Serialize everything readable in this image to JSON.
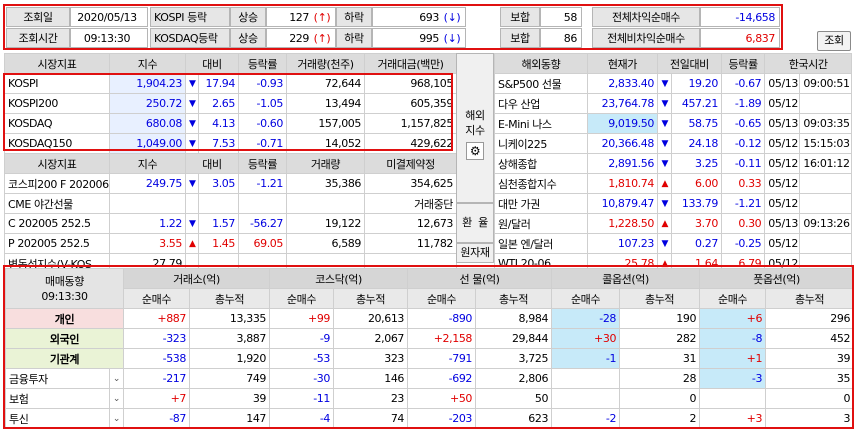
{
  "top": {
    "row1": {
      "date_label": "조회일",
      "date_value": "2020/05/13",
      "kospi_label": "KOSPI 등락",
      "up_label": "상승",
      "up_value": "127",
      "up_arrow": "↑",
      "down_label": "하락",
      "down_value": "693",
      "down_arrow": "↓",
      "flat_label": "보합",
      "flat_value": "58",
      "arb_label": "전체차익순매수",
      "arb_value": "-14,658"
    },
    "row2": {
      "time_label": "조회시간",
      "time_value": "09:13:30",
      "kosdaq_label": "KOSDAQ등락",
      "up_label": "상승",
      "up_value": "229",
      "up_arrow": "↑",
      "down_label": "하락",
      "down_value": "995",
      "down_arrow": "↓",
      "flat_label": "보합",
      "flat_value": "86",
      "nonarb_label": "전체비차익순매수",
      "nonarb_value": "6,837"
    },
    "query_button": "조회"
  },
  "market": {
    "headers": [
      "시장지표",
      "지수",
      "대비",
      "등락률",
      "거래량(천주)",
      "거래대금(백만)"
    ],
    "rows": [
      {
        "name": "KOSPI",
        "index": "1,904.23",
        "arrow": "▼",
        "change": "17.94",
        "rate": "-0.93",
        "volume": "72,644",
        "amount": "968,105"
      },
      {
        "name": "KOSPI200",
        "index": "250.72",
        "arrow": "▼",
        "change": "2.65",
        "rate": "-1.05",
        "volume": "13,494",
        "amount": "605,359"
      },
      {
        "name": "KOSDAQ",
        "index": "680.08",
        "arrow": "▼",
        "change": "4.13",
        "rate": "-0.60",
        "volume": "157,005",
        "amount": "1,157,825"
      },
      {
        "name": "KOSDAQ150",
        "index": "1,049.00",
        "arrow": "▼",
        "change": "7.53",
        "rate": "-0.71",
        "volume": "14,052",
        "amount": "429,622"
      }
    ],
    "headers2": [
      "시장지표",
      "지수",
      "대비",
      "등락률",
      "거래량",
      "미결제약정"
    ],
    "rows2": [
      {
        "name": "코스피200 F 202006",
        "index": "249.75",
        "arrow": "▼",
        "change": "3.05",
        "rate": "-1.21",
        "volume": "35,386",
        "oi": "354,625"
      },
      {
        "name": "CME 야간선물",
        "index": "",
        "arrow": "",
        "change": "",
        "rate": "",
        "volume": "",
        "oi": "거래중단"
      },
      {
        "name": "C 202005 252.5",
        "index": "1.22",
        "arrow": "▼",
        "change": "1.57",
        "rate": "-56.27",
        "volume": "19,122",
        "oi": "12,673"
      },
      {
        "name": "P 202005 252.5",
        "index": "3.55",
        "arrow": "▲",
        "change": "1.45",
        "rate": "69.05",
        "volume": "6,589",
        "oi": "11,782"
      },
      {
        "name": "변동성지수(V-KOS",
        "index": "27.79",
        "arrow": "",
        "change": "",
        "rate": "",
        "volume": "",
        "oi": ""
      }
    ]
  },
  "side": {
    "overseas_label": "해외\n지수",
    "overseas_l1": "해외",
    "overseas_l2": "지수",
    "fx_l1": "환",
    "fx_l2": "율",
    "raw_label": "원자재"
  },
  "world": {
    "headers": [
      "해외동향",
      "현재가",
      "전일대비",
      "등락률",
      "한국시간"
    ],
    "rows": [
      {
        "name": "S&P500 선물",
        "price": "2,833.40",
        "arrow": "▼",
        "change": "19.20",
        "rate": "-0.67",
        "date": "05/13",
        "time": "09:00:51"
      },
      {
        "name": "다우 산업",
        "price": "23,764.78",
        "arrow": "▼",
        "change": "457.21",
        "rate": "-1.89",
        "date": "05/12",
        "time": ""
      },
      {
        "name": "E-Mini 나스",
        "price": "9,019.50",
        "arrow": "▼",
        "change": "58.75",
        "rate": "-0.65",
        "date": "05/13",
        "time": "09:03:35"
      },
      {
        "name": "니케이225",
        "price": "20,366.48",
        "arrow": "▼",
        "change": "24.18",
        "rate": "-0.12",
        "date": "05/12",
        "time": "15:15:03"
      },
      {
        "name": "상해종합",
        "price": "2,891.56",
        "arrow": "▼",
        "change": "3.25",
        "rate": "-0.11",
        "date": "05/12",
        "time": "16:01:12"
      },
      {
        "name": "심천종합지수",
        "price": "1,810.74",
        "arrow": "▲",
        "change": "6.00",
        "rate": "0.33",
        "date": "05/12",
        "time": ""
      },
      {
        "name": "대만 가권",
        "price": "10,879.47",
        "arrow": "▼",
        "change": "133.79",
        "rate": "-1.21",
        "date": "05/12",
        "time": ""
      },
      {
        "name": "원/달러",
        "price": "1,228.50",
        "arrow": "▲",
        "change": "3.70",
        "rate": "0.30",
        "date": "05/13",
        "time": "09:13:26"
      },
      {
        "name": "일본 엔/달러",
        "price": "107.23",
        "arrow": "▼",
        "change": "0.27",
        "rate": "-0.25",
        "date": "05/12",
        "time": ""
      },
      {
        "name": "WTI 20-06",
        "price": "25.78",
        "arrow": "▲",
        "change": "1.64",
        "rate": "6.79",
        "date": "05/12",
        "time": ""
      }
    ]
  },
  "trade": {
    "title": "매매동향",
    "time": "09:13:30",
    "groups": [
      "거래소(억)",
      "코스닥(억)",
      "선  물(억)",
      "콜옵션(억)",
      "풋옵션(억)"
    ],
    "sub": [
      "순매수",
      "총누적"
    ],
    "rows": [
      {
        "name": "개인",
        "dd": false,
        "vals": [
          "+887",
          "13,335",
          "+99",
          "20,613",
          "-890",
          "8,984",
          "-28",
          "190",
          "+6",
          "296"
        ]
      },
      {
        "name": "외국인",
        "dd": false,
        "vals": [
          "-323",
          "3,887",
          "-9",
          "2,067",
          "+2,158",
          "29,844",
          "+30",
          "282",
          "-8",
          "452"
        ]
      },
      {
        "name": "기관계",
        "dd": false,
        "vals": [
          "-538",
          "1,920",
          "-53",
          "323",
          "-791",
          "3,725",
          "-1",
          "31",
          "+1",
          "39"
        ]
      },
      {
        "name": "금융투자",
        "dd": true,
        "vals": [
          "-217",
          "749",
          "-30",
          "146",
          "-692",
          "2,806",
          "",
          "28",
          "-3",
          "35"
        ]
      },
      {
        "name": "보험",
        "dd": true,
        "vals": [
          "+7",
          "39",
          "-11",
          "23",
          "+50",
          "50",
          "",
          "0",
          "",
          "0"
        ]
      },
      {
        "name": "투신",
        "dd": true,
        "vals": [
          "-87",
          "147",
          "-4",
          "74",
          "-203",
          "623",
          "-2",
          "2",
          "+3",
          "3"
        ]
      }
    ]
  },
  "colors": {
    "up": "#e00000",
    "down": "#0000e0",
    "highlight": "#e01010"
  }
}
